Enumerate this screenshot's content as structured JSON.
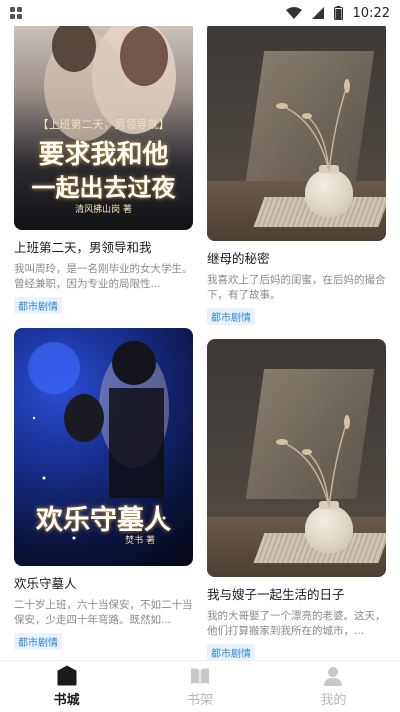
{
  "status_bar": {
    "time": "10:22"
  },
  "books": [
    {
      "title": "上班第二天，男领导和我",
      "desc": "我叫周玲，是一名刚毕业的女大学生。曾经兼职，因为专业的局限性...",
      "tag": "都市剧情",
      "cover": {
        "banner": "【上班第二天，男领导就】",
        "big_line1": "要求我和他",
        "big_line2": "一起出去过夜",
        "credit": "清风拂山岗 著"
      }
    },
    {
      "title": "继母的秘密",
      "desc": "我喜欢上了后妈的闺蜜，在后妈的撮合下，有了故事。",
      "tag": "都市剧情"
    },
    {
      "title": "欢乐守墓人",
      "desc": "二十岁上班，六十当保安，不如二十当保安，少走四十年弯路。既然如...",
      "tag": "都市剧情",
      "cover": {
        "big_line1": "欢乐守墓人",
        "credit": "焚书 著"
      }
    },
    {
      "title": "我与嫂子一起生活的日子",
      "desc": "我的大哥娶了一个漂亮的老婆。这天，他们打算搬家到我所在的城市，...",
      "tag": "都市剧情"
    }
  ],
  "tabs": [
    {
      "label": "书城",
      "icon": "bookstore-icon",
      "active": true
    },
    {
      "label": "书架",
      "icon": "bookshelf-icon",
      "active": false
    },
    {
      "label": "我的",
      "icon": "profile-icon",
      "active": false
    }
  ],
  "colors": {
    "accent": "#2e86de",
    "active_tab": "#1a1a1a",
    "inactive_tab": "#b8b8b8"
  }
}
